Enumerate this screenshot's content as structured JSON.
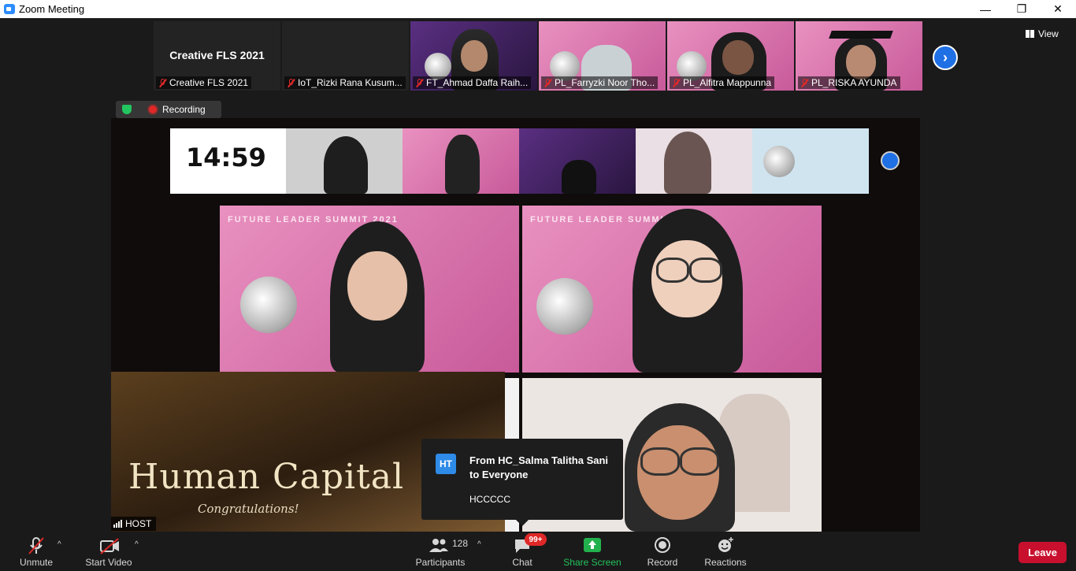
{
  "window": {
    "title": "Zoom Meeting",
    "minimize": "—",
    "restore": "❐",
    "close": "✕"
  },
  "thumbnails": [
    {
      "name": "Creative FLS 2021",
      "center_text": "Creative FLS 2021"
    },
    {
      "name": "IoT_Rizki Rana Kusum..."
    },
    {
      "name": "FT_Ahmad Daffa Raih..."
    },
    {
      "name": "PL_Farryzki Noor Tho..."
    },
    {
      "name": "PL_Alfitra Mappunna"
    },
    {
      "name": "PL_RISKA AYUNDA"
    }
  ],
  "view_button": {
    "label": "View"
  },
  "recording": {
    "label": "Recording"
  },
  "share": {
    "clock": "14:59",
    "banner_title": "Human Capital",
    "banner_subtitle": "Congratulations!",
    "poster_title": "FUTURE LEADER SUMMIT 2021"
  },
  "host_label": "HOST",
  "chat_popup": {
    "avatar": "HT",
    "from": "From HC_Salma Talitha Sani to Everyone",
    "message": "HCCCCC"
  },
  "toolbar": {
    "unmute": "Unmute",
    "start_video": "Start Video",
    "participants": "Participants",
    "participants_count": "128",
    "chat": "Chat",
    "chat_badge": "99+",
    "share_screen": "Share Screen",
    "record": "Record",
    "reactions": "Reactions",
    "leave": "Leave"
  },
  "colors": {
    "accent": "#2d8cff",
    "share_green": "#23b14d",
    "leave_red": "#c8102e",
    "badge_red": "#e02828"
  }
}
